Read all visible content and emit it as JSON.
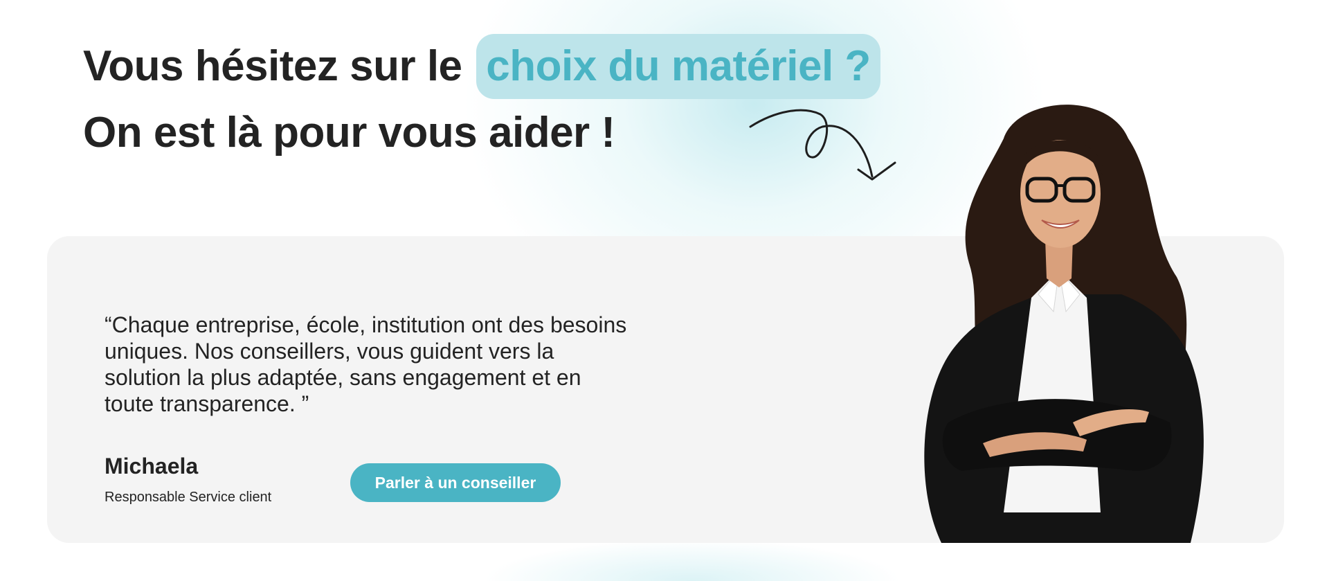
{
  "headline": {
    "line1_prefix": "Vous hésitez sur le",
    "line1_highlight": "choix du matériel ?",
    "line2": "On est là pour vous aider !"
  },
  "testimonial": {
    "quote": "“Chaque entreprise, école, institution ont des besoins uniques. Nos conseillers, vous guident vers la solution la plus adaptée, sans engagement et en toute transparence. ”",
    "name": "Michaela",
    "role": "Responsable Service client"
  },
  "cta": {
    "label": "Parler à un conseiller"
  },
  "colors": {
    "accent": "#4ab4c4",
    "highlight_bg": "#bde4ea",
    "card_bg": "#f4f4f4",
    "text": "#232323"
  },
  "icons": {
    "arrow": "curly-arrow-icon"
  }
}
